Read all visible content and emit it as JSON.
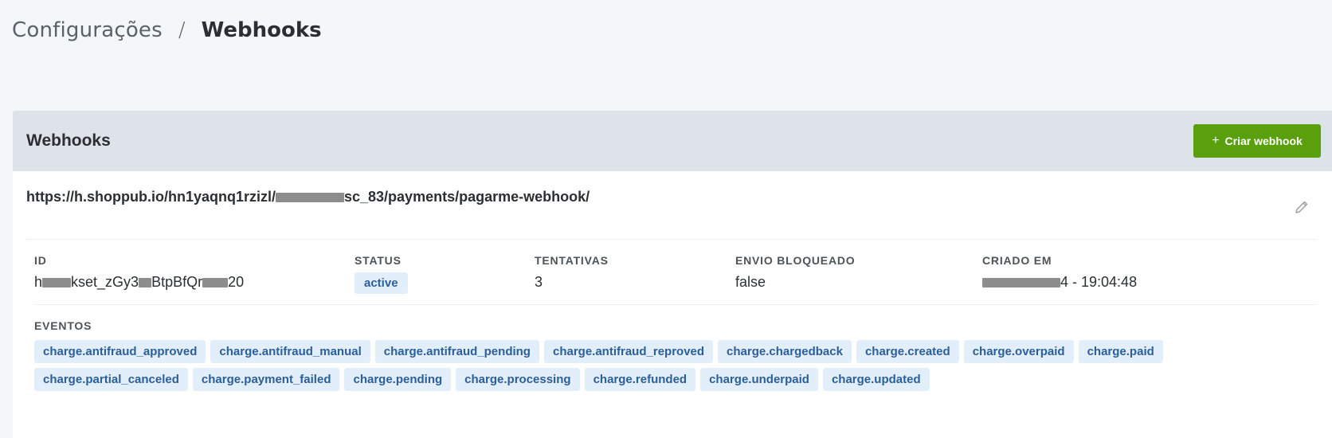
{
  "breadcrumb": {
    "parent": "Configurações",
    "separator": "/",
    "current": "Webhooks"
  },
  "card": {
    "title": "Webhooks",
    "create_button": {
      "icon": "plus-icon",
      "label": "Criar webhook"
    }
  },
  "webhook": {
    "url_start": "https://h.shoppub.io/hn1yaqnq1rzizl/",
    "url_end": "sc_83/payments/pagarme-webhook/",
    "edit_icon": "pencil-icon",
    "fields": {
      "id": {
        "label": "ID",
        "start": "h",
        "middle1": "kset_zGy3",
        "middle2": "BtpBfQr",
        "end": "20"
      },
      "status": {
        "label": "STATUS",
        "value": "active"
      },
      "attempts": {
        "label": "TENTATIVAS",
        "value": "3"
      },
      "blocked": {
        "label": "ENVIO BLOQUEADO",
        "value": "false"
      },
      "created": {
        "label": "CRIADO EM",
        "value_end": "4 - 19:04:48"
      }
    },
    "events_label": "EVENTOS",
    "events": [
      "charge.antifraud_approved",
      "charge.antifraud_manual",
      "charge.antifraud_pending",
      "charge.antifraud_reproved",
      "charge.chargedback",
      "charge.created",
      "charge.overpaid",
      "charge.paid",
      "charge.partial_canceled",
      "charge.payment_failed",
      "charge.pending",
      "charge.processing",
      "charge.refunded",
      "charge.underpaid",
      "charge.updated"
    ]
  },
  "colors": {
    "accent": "#5a9f0c",
    "tag_bg": "#e2eef9",
    "tag_text": "#2b5f9a",
    "header_bg": "#dde3e8",
    "page_bg": "#f4f7fa"
  }
}
